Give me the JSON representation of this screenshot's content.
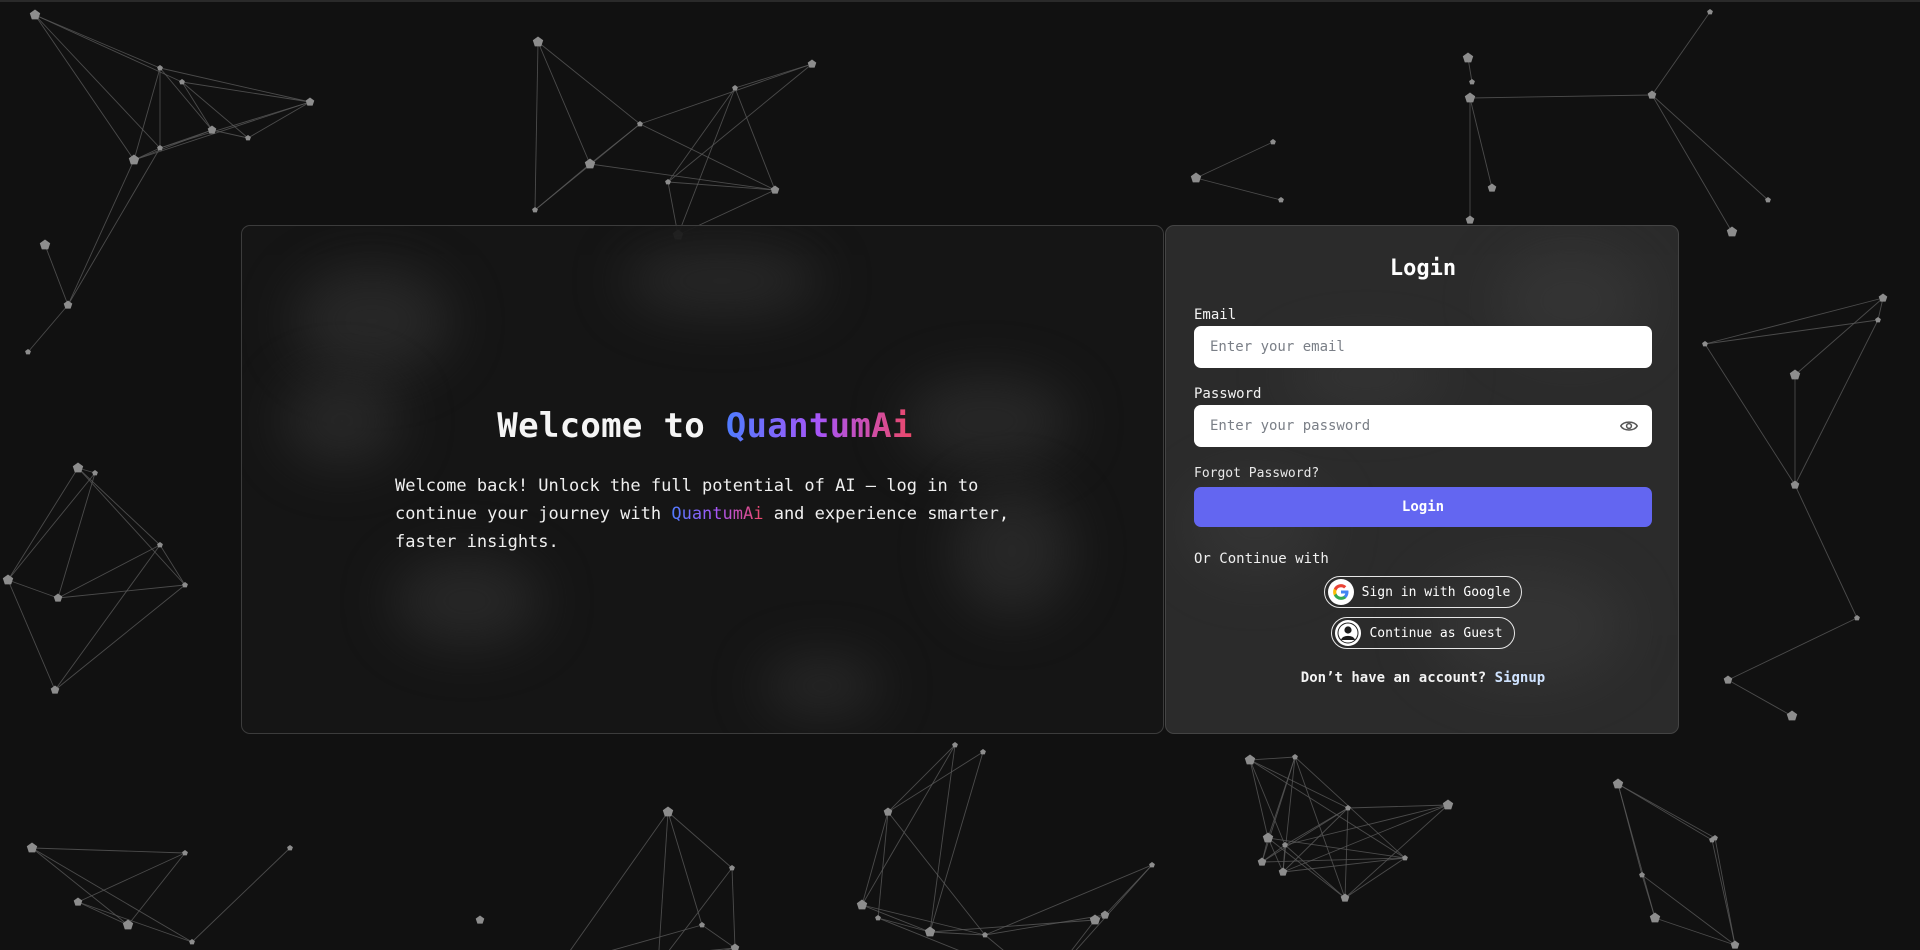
{
  "welcome": {
    "title_prefix": "Welcome to ",
    "brand": "QuantumAi",
    "text_part1": "Welcome back! Unlock the full potential of AI — log in to continue your journey with ",
    "text_brand": "QuantumAi",
    "text_part2": " and experience smarter, faster insights."
  },
  "login": {
    "title": "Login",
    "email_label": "Email",
    "email_placeholder": "Enter your email",
    "password_label": "Password",
    "password_placeholder": "Enter your password",
    "forgot_password": "Forgot Password?",
    "login_button": "Login",
    "or_continue": "Or Continue with",
    "google_button": "Sign in with Google",
    "guest_button": "Continue as Guest",
    "signup_prompt": "Don’t have an account? ",
    "signup_link": "Signup"
  },
  "colors": {
    "accent": "#6366f1",
    "background": "#111111",
    "brand_gradient_start": "#4f7cff",
    "brand_gradient_mid": "#a855f7",
    "brand_gradient_end": "#ec4868"
  },
  "icons": {
    "password_toggle": "eye-icon",
    "google": "google-g-icon",
    "guest": "guest-avatar-icon"
  }
}
